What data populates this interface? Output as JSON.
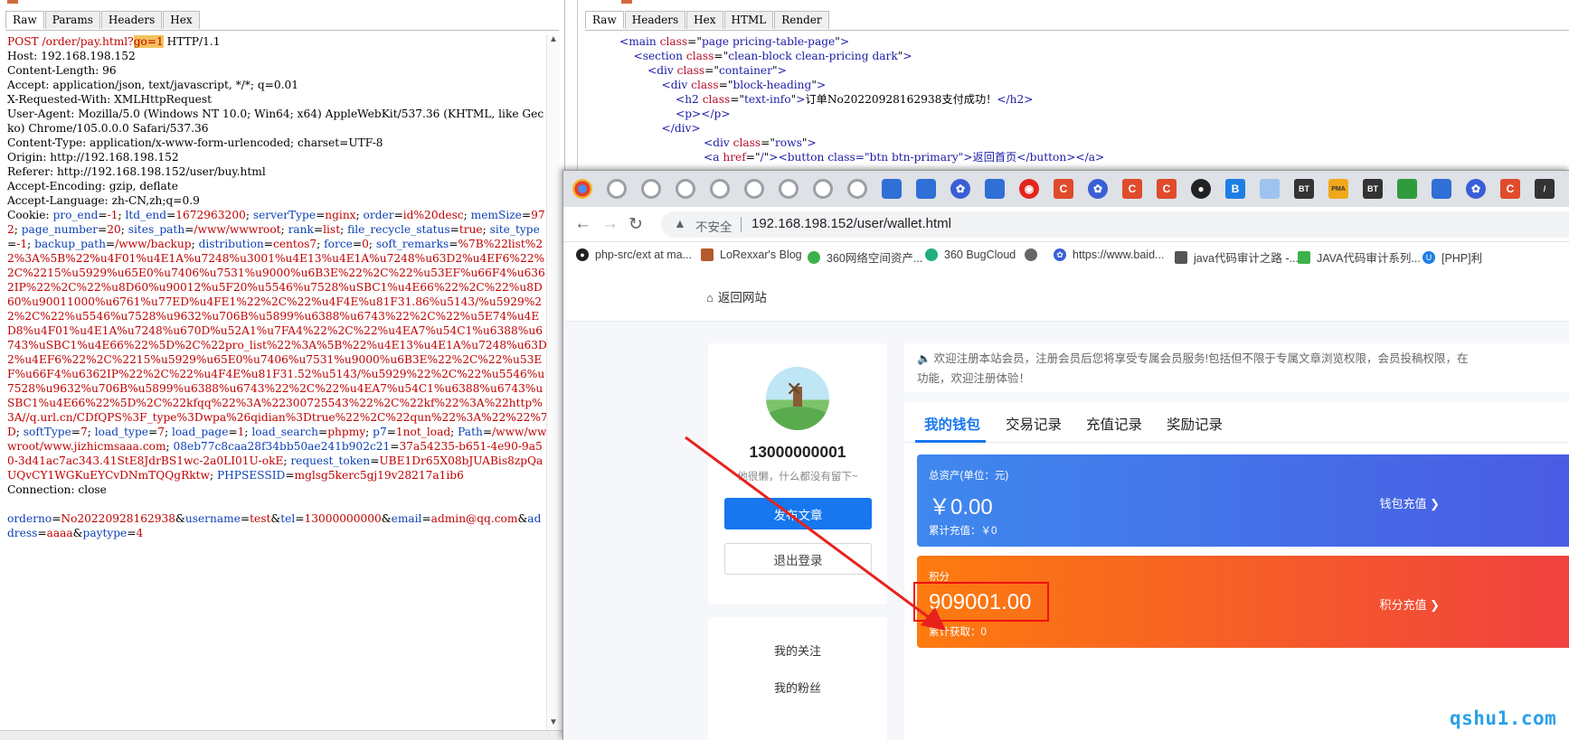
{
  "request": {
    "tabs": [
      "Raw",
      "Params",
      "Headers",
      "Hex"
    ],
    "active_tab": "Raw",
    "line_post_a": "POST /order/pay.html?",
    "line_post_hl": "go=1",
    "line_post_b": " HTTP/1.1",
    "host": "Host: 192.168.198.152",
    "content_length": "Content-Length: 96",
    "accept": "Accept: application/json, text/javascript, */*; q=0.01",
    "x_requested": "X-Requested-With: XMLHttpRequest",
    "user_agent": "User-Agent: Mozilla/5.0 (Windows NT 10.0; Win64; x64) AppleWebKit/537.36 (KHTML, like Gecko) Chrome/105.0.0.0 Safari/537.36",
    "content_type": "Content-Type: application/x-www-form-urlencoded; charset=UTF-8",
    "origin": "Origin: http://192.168.198.152",
    "referer": "Referer: http://192.168.198.152/user/buy.html",
    "accept_encoding": "Accept-Encoding: gzip, deflate",
    "accept_language": "Accept-Language: zh-CN,zh;q=0.9",
    "cookie_label": "Cookie: ",
    "cookie": [
      {
        "k": "pro_end",
        "v": "-1"
      },
      {
        "k": "ltd_end",
        "v": "1672963200"
      },
      {
        "k": "serverType",
        "v": "nginx"
      },
      {
        "k": "order",
        "v": "id%20desc"
      },
      {
        "k": "memSize",
        "v": "972"
      },
      {
        "k": "page_number",
        "v": "20"
      },
      {
        "k": "sites_path",
        "v": "/www/wwwroot"
      },
      {
        "k": "rank",
        "v": "list"
      },
      {
        "k": "file_recycle_status",
        "v": "true"
      },
      {
        "k": "site_type",
        "v": "-1"
      },
      {
        "k": "backup_path",
        "v": "/www/backup"
      },
      {
        "k": "distribution",
        "v": "centos7"
      },
      {
        "k": "force",
        "v": "0"
      },
      {
        "k": "soft_remarks",
        "v": "%7B%22list%22%3A%5B%22%u4F01%u4E1A%u7248%u3001%u4E13%u4E1A%u7248%u63D2%u4EF6%22%2C%2215%u5929%u65E0%u7406%u7531%u9000%u6B3E%22%2C%22%u53EF%u66F4%u6362IP%22%2C%22%u8D60%u90012%u5F20%u5546%u7528%uSBC1%u4E66%22%2C%22%u8D60%u90011000%u6761%u77ED%u4FE1%22%2C%22%u4F4E%u81F31.86%u5143/%u5929%22%2C%22%u5546%u7528%u9632%u706B%u5899%u6388%u6743%22%2C%22%u5E74%u4ED8%u4F01%u4E1A%u7248%u670D%u52A1%u7FA4%22%2C%22%u4EA7%u54C1%u6388%u6743%uSBC1%u4E66%22%5D%2C%22pro_list%22%3A%5B%22%u4E13%u4E1A%u7248%u63D2%u4EF6%22%2C%2215%u5929%u65E0%u7406%u7531%u9000%u6B3E%22%2C%22%u53EF%u66F4%u6362IP%22%2C%22%u4F4E%u81F31.52%u5143/%u5929%22%2C%22%u5546%u7528%u9632%u706B%u5899%u6388%u6743%22%2C%22%u4EA7%u54C1%u6388%u6743%uSBC1%u4E66%22%5D%2C%22kfqq%22%3A%22300725543%22%2C%22kf%22%3A%22http%3A//q.url.cn/CDfQPS%3F_type%3Dwpa%26qidian%3Dtrue%22%2C%22qun%22%3A%22%22%7D"
      },
      {
        "k": "softType",
        "v": "7"
      },
      {
        "k": "load_type",
        "v": "7"
      },
      {
        "k": "load_page",
        "v": "1"
      },
      {
        "k": "load_search",
        "v": "phpmy"
      },
      {
        "k": "p7",
        "v": "1not_load"
      },
      {
        "k": "Path",
        "v": "/www/wwwroot/www.jizhicmsaaa.com"
      },
      {
        "k": "08eb77c8caa28f34bb50ae241b902c21",
        "v": "37a54235-b651-4e90-9a50-3d41ac7ac343.41StE8JdrBS1wc-2a0LI01U-okE"
      },
      {
        "k": "request_token",
        "v": "UBE1Dr65X08bJUABis8zpQaUQvCY1WGKuEYCvDNmTQQgRktw"
      },
      {
        "k": "PHPSESSID",
        "v": "mglsg5kerc5gj19v28217a1ib6"
      }
    ],
    "connection": "Connection: close",
    "body": [
      {
        "k": "orderno",
        "v": "No20220928162938"
      },
      {
        "k": "username",
        "v": "test"
      },
      {
        "k": "tel",
        "v": "13000000000"
      },
      {
        "k": "email",
        "v": "admin@qq.com"
      },
      {
        "k": "address",
        "v": "aaaa"
      },
      {
        "k": "paytype",
        "v": "4"
      }
    ]
  },
  "response": {
    "tabs": [
      "Raw",
      "Headers",
      "Hex",
      "HTML",
      "Render"
    ],
    "active_tab": "Raw",
    "lines": [
      {
        "indent": 0,
        "tag": "main",
        "attr": "class",
        "val": "page pricing-table-page",
        "text": "",
        "close": ""
      },
      {
        "indent": 4,
        "tag": "section",
        "attr": "class",
        "val": "clean-block clean-pricing dark",
        "text": "",
        "close": ""
      },
      {
        "indent": 8,
        "tag": "div",
        "attr": "class",
        "val": "container",
        "text": "",
        "close": ""
      },
      {
        "indent": 12,
        "tag": "div",
        "attr": "class",
        "val": "block-heading",
        "text": "",
        "close": ""
      },
      {
        "indent": 16,
        "tag": "h2",
        "attr": "class",
        "val": "text-info",
        "text": "订单No20220928162938支付成功！",
        "close": "</h2>"
      },
      {
        "indent": 16,
        "tag": "p",
        "attr": "",
        "val": "",
        "text": "",
        "close": "</p>"
      },
      {
        "indent": 12,
        "tag": "/div",
        "attr": "",
        "val": "",
        "text": "",
        "close": ""
      },
      {
        "indent": 24,
        "tag": "div",
        "attr": "class",
        "val": "rows",
        "text": "",
        "close": ""
      },
      {
        "indent": 24,
        "tag": "a",
        "attr": "href",
        "val": "/",
        "text": "",
        "close": "",
        "extra": "<button class=\"btn btn-primary\">返回首页</button></a>"
      }
    ]
  },
  "browser": {
    "url_warning": "不安全",
    "url": "192.168.198.152/user/wallet.html",
    "bookmarks": [
      "php-src/ext at ma...",
      "LoRexxar's Blog",
      "360网络空间资产...",
      "360 BugCloud",
      "",
      "https://www.baid...",
      "java代码审计之路 -...",
      "JAVA代码审计系列...",
      "[PHP]利"
    ]
  },
  "site": {
    "back_link": "返回网站",
    "phone": "13000000001",
    "bio": "他很懒，什么都没有留下~",
    "post_button": "发布文章",
    "logout_button": "退出登录",
    "menu": [
      "我的关注",
      "我的粉丝"
    ],
    "notice": "欢迎注册本站会员，注册会员后您将享受专属会员服务!包括但不限于专属文章浏览权限，会员投稿权限，在",
    "notice_line2": "功能，欢迎注册体验！",
    "wallet_tabs": [
      "我的钱包",
      "交易记录",
      "充值记录",
      "奖励记录"
    ],
    "asset_label": "总资产(单位：元)",
    "asset_value": "￥0.00",
    "asset_sub": "累计充值：￥0",
    "asset_action": "钱包充值",
    "points_label": "积分",
    "points_value": "909001.00",
    "points_sub": "累计获取：0",
    "points_action": "积分充值"
  },
  "watermark": "qshu1.com"
}
